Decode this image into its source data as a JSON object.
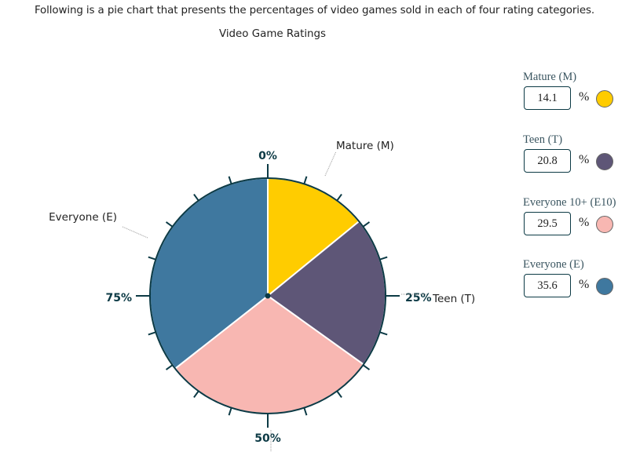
{
  "intro_text": "Following is a pie chart that presents the percentages of video games sold in each of four rating categories.",
  "legend": {
    "items": [
      {
        "label": "Mature (M)",
        "value": "14.1",
        "unit": "%",
        "color": "#ffcc00"
      },
      {
        "label": "Teen (T)",
        "value": "20.8",
        "unit": "%",
        "color": "#5e5677"
      },
      {
        "label": "Everyone 10+ (E10)",
        "value": "29.5",
        "unit": "%",
        "color": "#f8b7b2"
      },
      {
        "label": "Everyone (E)",
        "value": "35.6",
        "unit": "%",
        "color": "#3f789f"
      }
    ]
  },
  "chart_data": {
    "type": "pie",
    "title": "Video Game Ratings",
    "slices": [
      {
        "label": "Mature (M)",
        "value": 14.1,
        "color": "#ffcc00"
      },
      {
        "label": "Teen (T)",
        "value": 20.8,
        "color": "#5e5677"
      },
      {
        "label": "Everyone 10+ (E10)",
        "value": 29.5,
        "color": "#f8b7b2"
      },
      {
        "label": "Everyone (E)",
        "value": 35.6,
        "color": "#3f789f"
      }
    ],
    "start": "top",
    "direction": "clockwise",
    "tick_step_percent": 5,
    "tick_labels": [
      "0%",
      "25%",
      "50%",
      "75%"
    ],
    "slice_labels": [
      {
        "label": "Mature (M)",
        "text": "Mature (M)"
      },
      {
        "label": "Teen (T)",
        "text": "Teen (T)"
      },
      {
        "label": "Everyone (E)",
        "text": "Everyone (E)"
      }
    ],
    "outline_color": "#0c3a45"
  }
}
